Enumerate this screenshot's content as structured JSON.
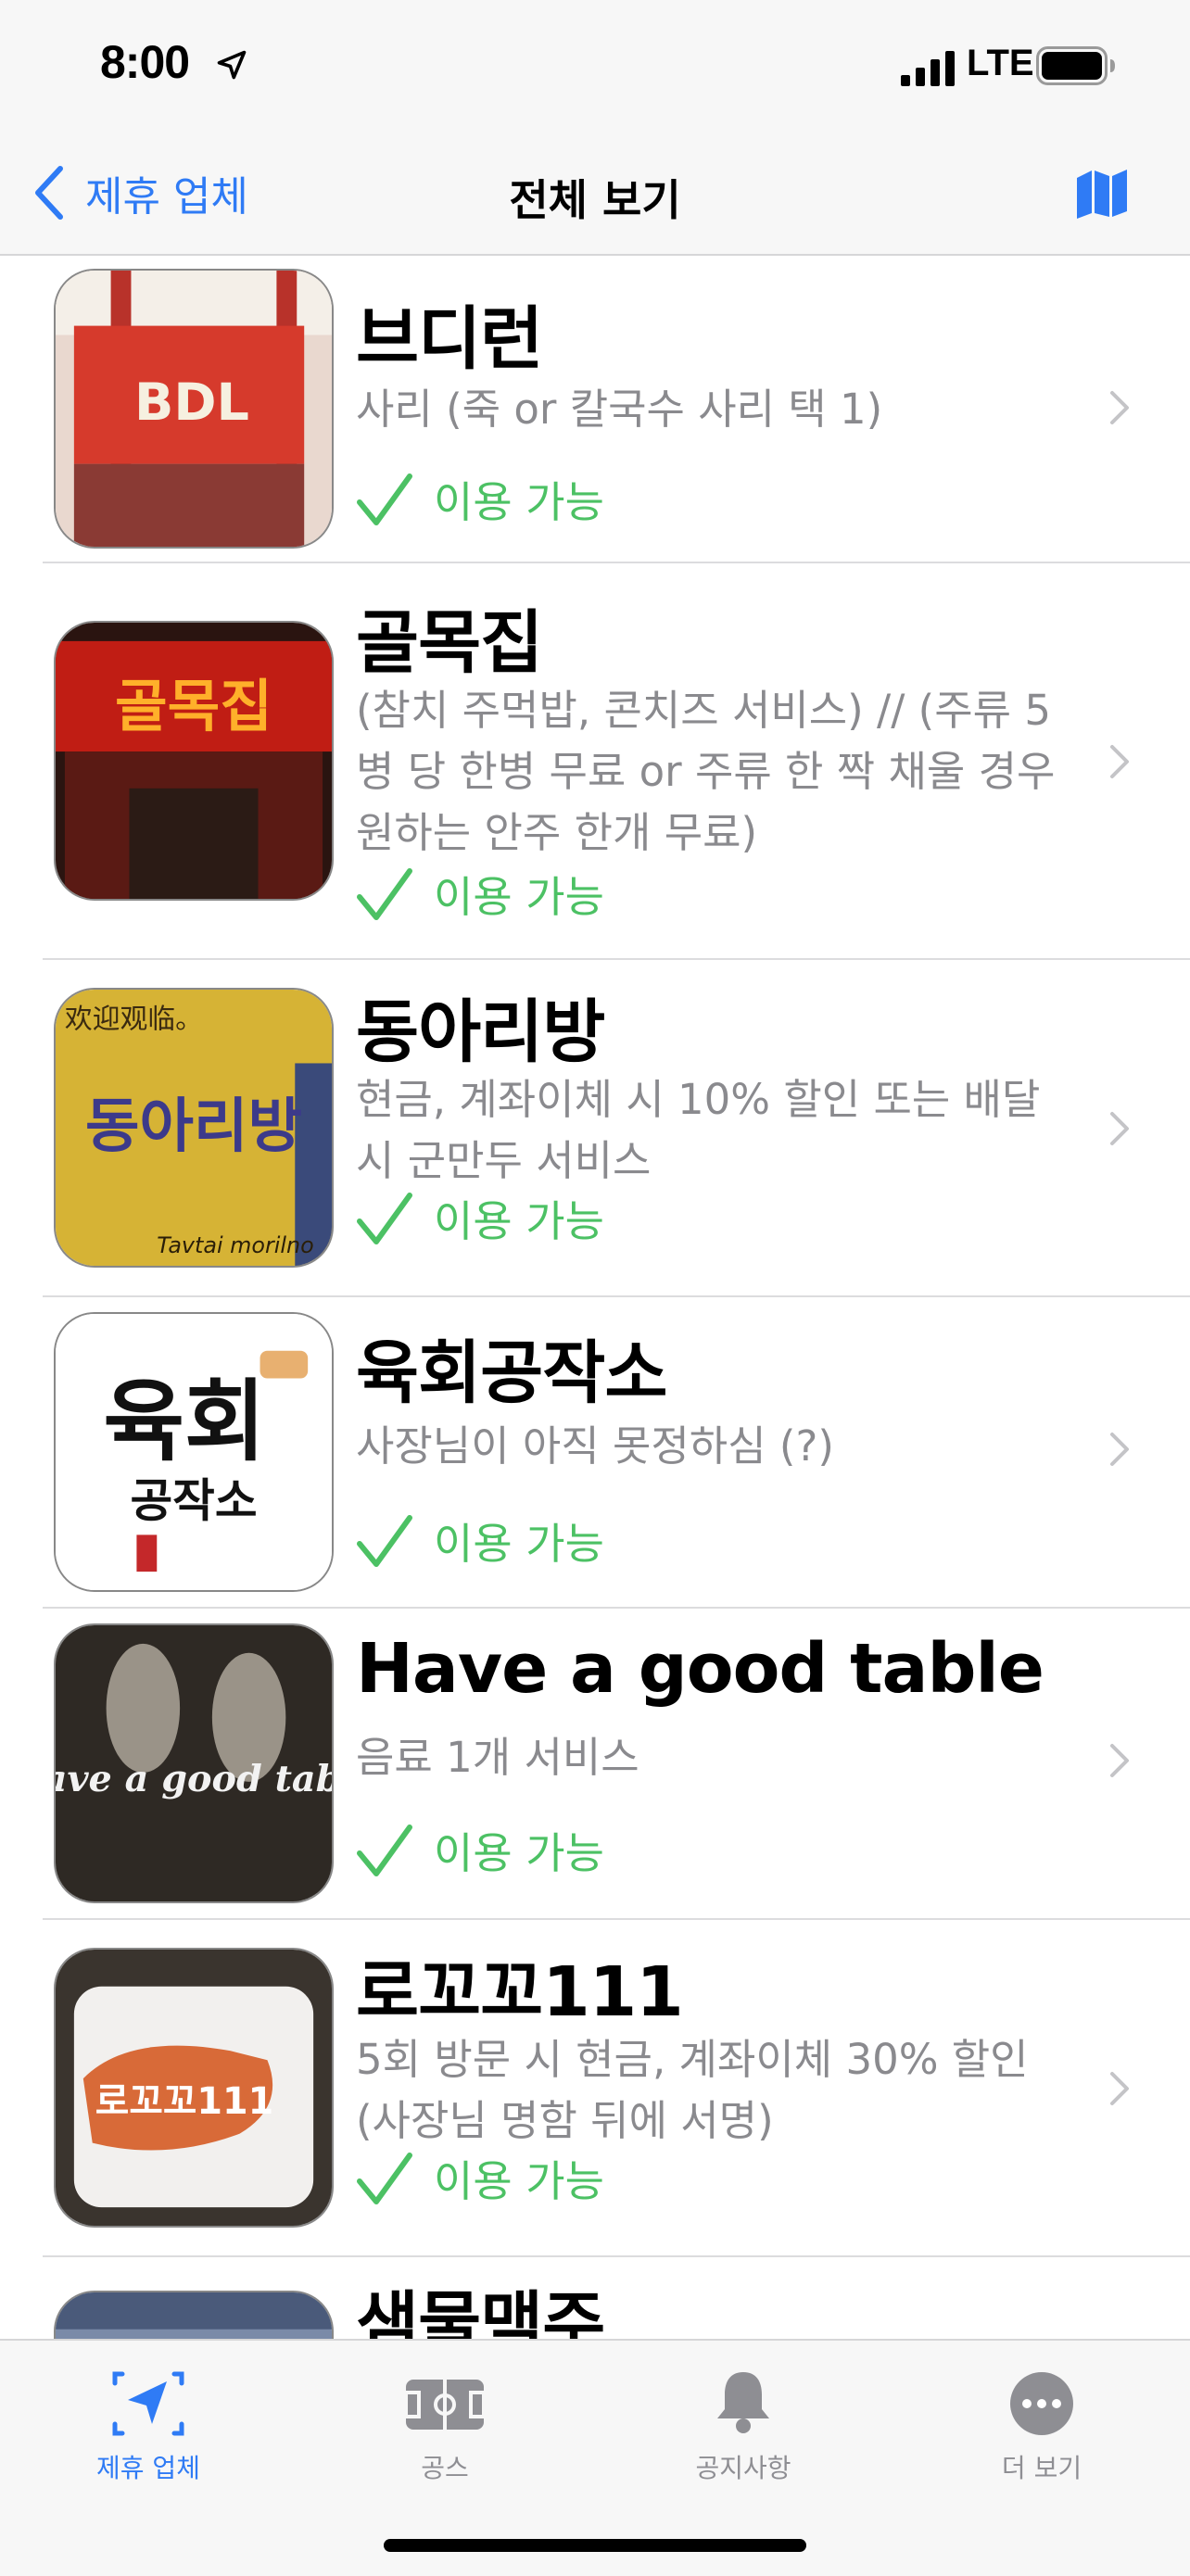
{
  "status_bar": {
    "time": "8:00",
    "network": "LTE"
  },
  "nav": {
    "back_label": "제휴 업체",
    "title": "전체 보기",
    "map_icon": "map-icon"
  },
  "colors": {
    "accent": "#2f7bf5",
    "available": "#4cc164",
    "secondary_text": "#8a8a8e"
  },
  "stores": [
    {
      "name": "브디런",
      "desc": "사리 (죽 or 칼국수 사리 택 1)",
      "status": "이용 가능",
      "thumb_text": "BDL"
    },
    {
      "name": "골목집",
      "desc": "(참치 주먹밥, 콘치즈 서비스) // (주류 5병 당 한병 무료 or 주류 한 짝 채울 경우 원하는 안주 한개 무료)",
      "status": "이용 가능",
      "thumb_text": "골목집"
    },
    {
      "name": "동아리방",
      "desc": "현금, 계좌이체 시 10% 할인 또는 배달 시 군만두 서비스",
      "status": "이용 가능",
      "thumb_text": "동아리방",
      "thumb_text_2": "欢迎观临。",
      "thumb_text_3": "Tavtai morilno"
    },
    {
      "name": "육회공작소",
      "desc": "사장님이 아직 못정하심 (?)",
      "status": "이용 가능",
      "thumb_text": "육회",
      "thumb_text_2": "공작소"
    },
    {
      "name": "Have a good table",
      "desc": "음료 1개 서비스",
      "status": "이용 가능",
      "thumb_text": "Have a good table"
    },
    {
      "name": "로꼬꼬111",
      "desc": "5회 방문 시 현금, 계좌이체 30% 할인 (사장님 명함 뒤에 서명)",
      "status": "이용 가능",
      "thumb_text": "로꼬꼬111"
    },
    {
      "name": "샘물맥주"
    }
  ],
  "tabs": [
    {
      "label": "제휴 업체",
      "icon": "location-arrow-icon",
      "active": true
    },
    {
      "label": "공스",
      "icon": "soccer-field-icon",
      "active": false
    },
    {
      "label": "공지사항",
      "icon": "bell-icon",
      "active": false
    },
    {
      "label": "더 보기",
      "icon": "ellipsis-circle-icon",
      "active": false
    }
  ]
}
